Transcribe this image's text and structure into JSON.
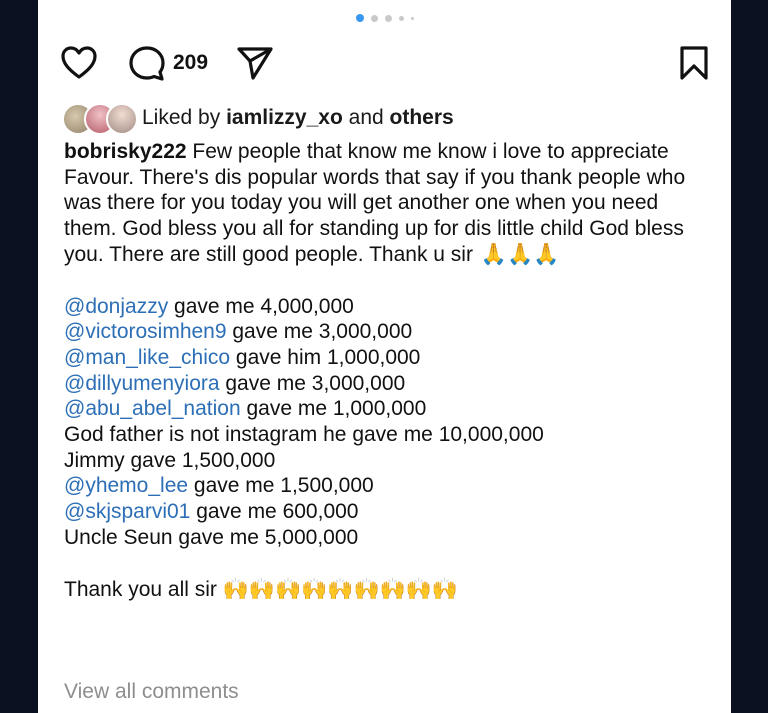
{
  "pager": {
    "dots": 5,
    "active": 0
  },
  "actions": {
    "like_icon": "heart-icon",
    "comment_icon": "comment-icon",
    "comment_count": "209",
    "share_icon": "send-icon",
    "save_icon": "bookmark-icon"
  },
  "likes": {
    "prefix": "Liked by",
    "user": "iamlizzy_xo",
    "conjunction": "and",
    "others": "others"
  },
  "caption": {
    "username": "bobrisky222",
    "text": "Few people that know me know i love to appreciate Favour. There's dis popular words that say if you thank people who was there for you today you will get another one when you need them. God bless you all for standing up for dis little child God bless you. There are still good people. Thank u sir",
    "emoji": "🙏🙏🙏",
    "lines": [
      {
        "mention": "@donjazzy",
        "text": " gave me 4,000,000"
      },
      {
        "mention": "@victorosimhen9",
        "text": " gave me 3,000,000"
      },
      {
        "mention": "@man_like_chico",
        "text": " gave him 1,000,000"
      },
      {
        "mention": "@dillyumenyiora",
        "text": " gave me 3,000,000"
      },
      {
        "mention": "@abu_abel_nation",
        "text": " gave me 1,000,000"
      },
      {
        "mention": "",
        "text": "God father is not instagram he gave me 10,000,000"
      },
      {
        "mention": "",
        "text": "Jimmy gave 1,500,000"
      },
      {
        "mention": "@yhemo_lee",
        "text": " gave me 1,500,000"
      },
      {
        "mention": "@skjsparvi01",
        "text": " gave me 600,000"
      },
      {
        "mention": "",
        "text": "Uncle Seun gave me 5,000,000"
      }
    ],
    "closing": "Thank you all sir",
    "closing_emoji": "🙌🙌🙌🙌🙌🙌🙌🙌🙌"
  },
  "view_all_comments": "View all comments",
  "colors": {
    "mention": "#2d6fb6",
    "active_dot": "#3897f0",
    "muted": "#8e8e8e"
  }
}
